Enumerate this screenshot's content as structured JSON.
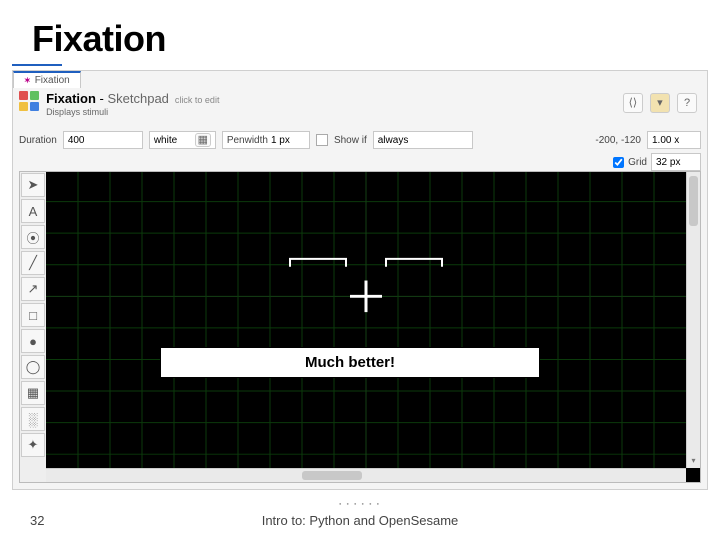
{
  "slide": {
    "title": "Fixation",
    "page_number": "32",
    "footer": "Intro to: Python and OpenSesame"
  },
  "tab": {
    "label": "Fixation"
  },
  "header": {
    "name": "Fixation",
    "type": "Sketchpad",
    "click_hint": "click to edit",
    "description": "Displays stimuli"
  },
  "toolbar": {
    "duration_label": "Duration",
    "duration_value": "400",
    "color_value": "white",
    "penwidth_label": "Penwidth",
    "penwidth_value": "1 px",
    "showif_label": "Show if",
    "showif_value": "always",
    "coords": "-200, -120",
    "zoom": "1.00 x",
    "grid_label": "Grid",
    "grid_value": "32 px"
  },
  "tools": [
    {
      "name": "pointer-tool",
      "glyph": "➤"
    },
    {
      "name": "text-tool",
      "glyph": "A"
    },
    {
      "name": "image-tool",
      "glyph": "⦿"
    },
    {
      "name": "line-tool",
      "glyph": "╱"
    },
    {
      "name": "arrow-tool",
      "glyph": "↗"
    },
    {
      "name": "rect-tool",
      "glyph": "□"
    },
    {
      "name": "circle-tool",
      "glyph": "●"
    },
    {
      "name": "ellipse-tool",
      "glyph": "◯"
    },
    {
      "name": "gabor-tool",
      "glyph": "▦"
    },
    {
      "name": "noise-tool",
      "glyph": "░"
    },
    {
      "name": "fixation-tool",
      "glyph": "✦"
    }
  ],
  "callout": {
    "text": "Much better!"
  }
}
